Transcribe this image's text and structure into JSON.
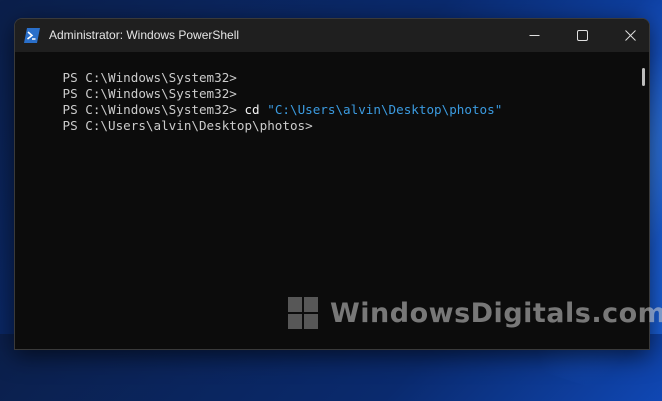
{
  "window": {
    "title": "Administrator: Windows PowerShell",
    "icon": "powershell-icon",
    "controls": {
      "minimize": "minimize-icon",
      "maximize": "maximize-icon",
      "close": "close-icon"
    }
  },
  "console": {
    "lines": [
      {
        "prompt": "PS C:\\Windows\\System32>",
        "command": "",
        "argument": ""
      },
      {
        "prompt": "PS C:\\Windows\\System32>",
        "command": "",
        "argument": ""
      },
      {
        "prompt": "PS C:\\Windows\\System32>",
        "command": " cd ",
        "argument": "\"C:\\Users\\alvin\\Desktop\\photos\""
      },
      {
        "prompt": "PS C:\\Users\\alvin\\Desktop\\photos>",
        "command": "",
        "argument": ""
      }
    ],
    "colors": {
      "text": "#cccccc",
      "argument": "#3b9be0",
      "background": "#0c0c0c"
    }
  },
  "watermark": {
    "text": "WindowsDigitals.com"
  }
}
